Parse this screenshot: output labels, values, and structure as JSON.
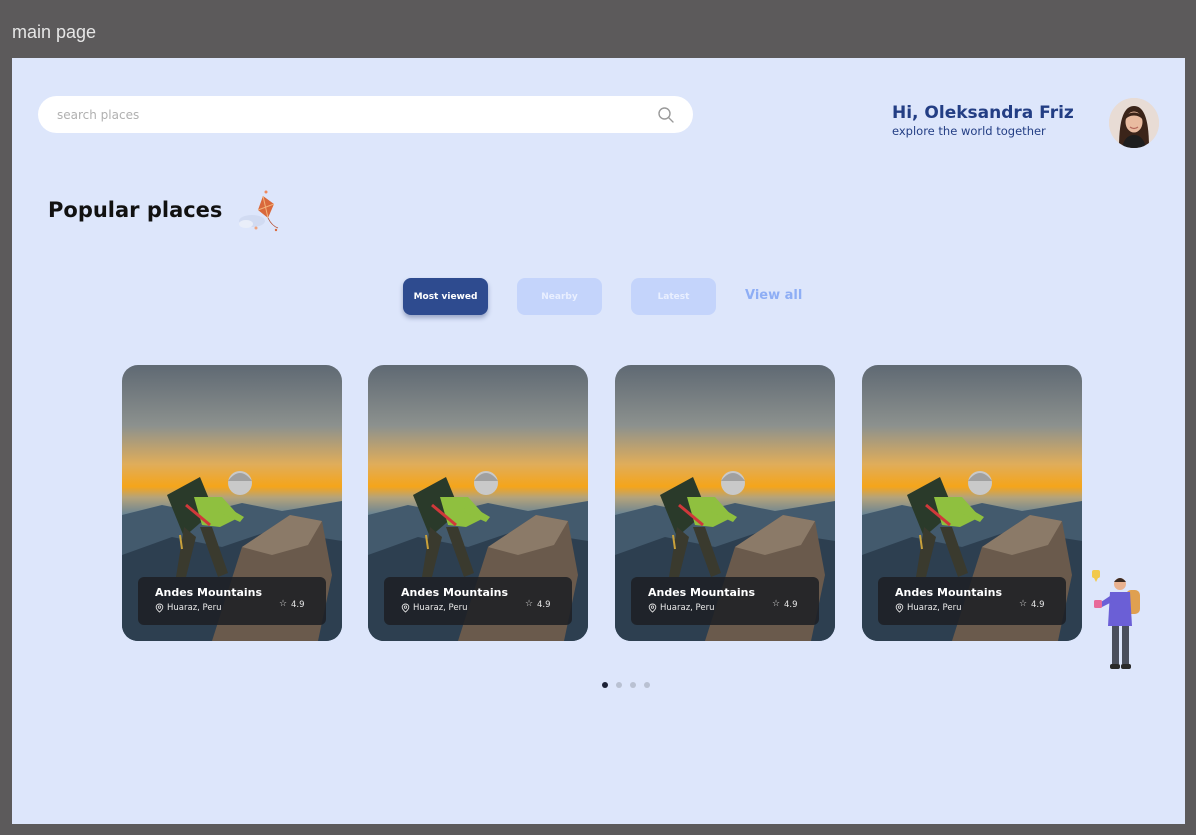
{
  "window": {
    "title": "main page"
  },
  "search": {
    "placeholder": "search places"
  },
  "user": {
    "greeting": "Hi, Oleksandra Friz",
    "subtitle": "explore the world together"
  },
  "section": {
    "title": "Popular places"
  },
  "filters": [
    {
      "label": "Most viewed",
      "active": true
    },
    {
      "label": "Nearby",
      "active": false
    },
    {
      "label": "Latest",
      "active": false
    }
  ],
  "view_all": "View all",
  "cards": [
    {
      "title": "Andes Mountains",
      "location": "Huaraz, Peru",
      "rating": "4.9"
    },
    {
      "title": "Andes Mountains",
      "location": "Huaraz, Peru",
      "rating": "4.9"
    },
    {
      "title": "Andes Mountains",
      "location": "Huaraz, Peru",
      "rating": "4.9"
    },
    {
      "title": "Andes Mountains",
      "location": "Huaraz, Peru",
      "rating": "4.9"
    }
  ],
  "pagination": {
    "total": 4,
    "active": 1
  },
  "colors": {
    "background": "#dde6fb",
    "accent": "#233e84",
    "button_active": "#2e4b8f",
    "button_inactive": "#c4d4fb",
    "link": "#8eaef5"
  },
  "icons": {
    "search": "search-icon",
    "location": "location-pin-icon",
    "rating": "star-icon"
  }
}
